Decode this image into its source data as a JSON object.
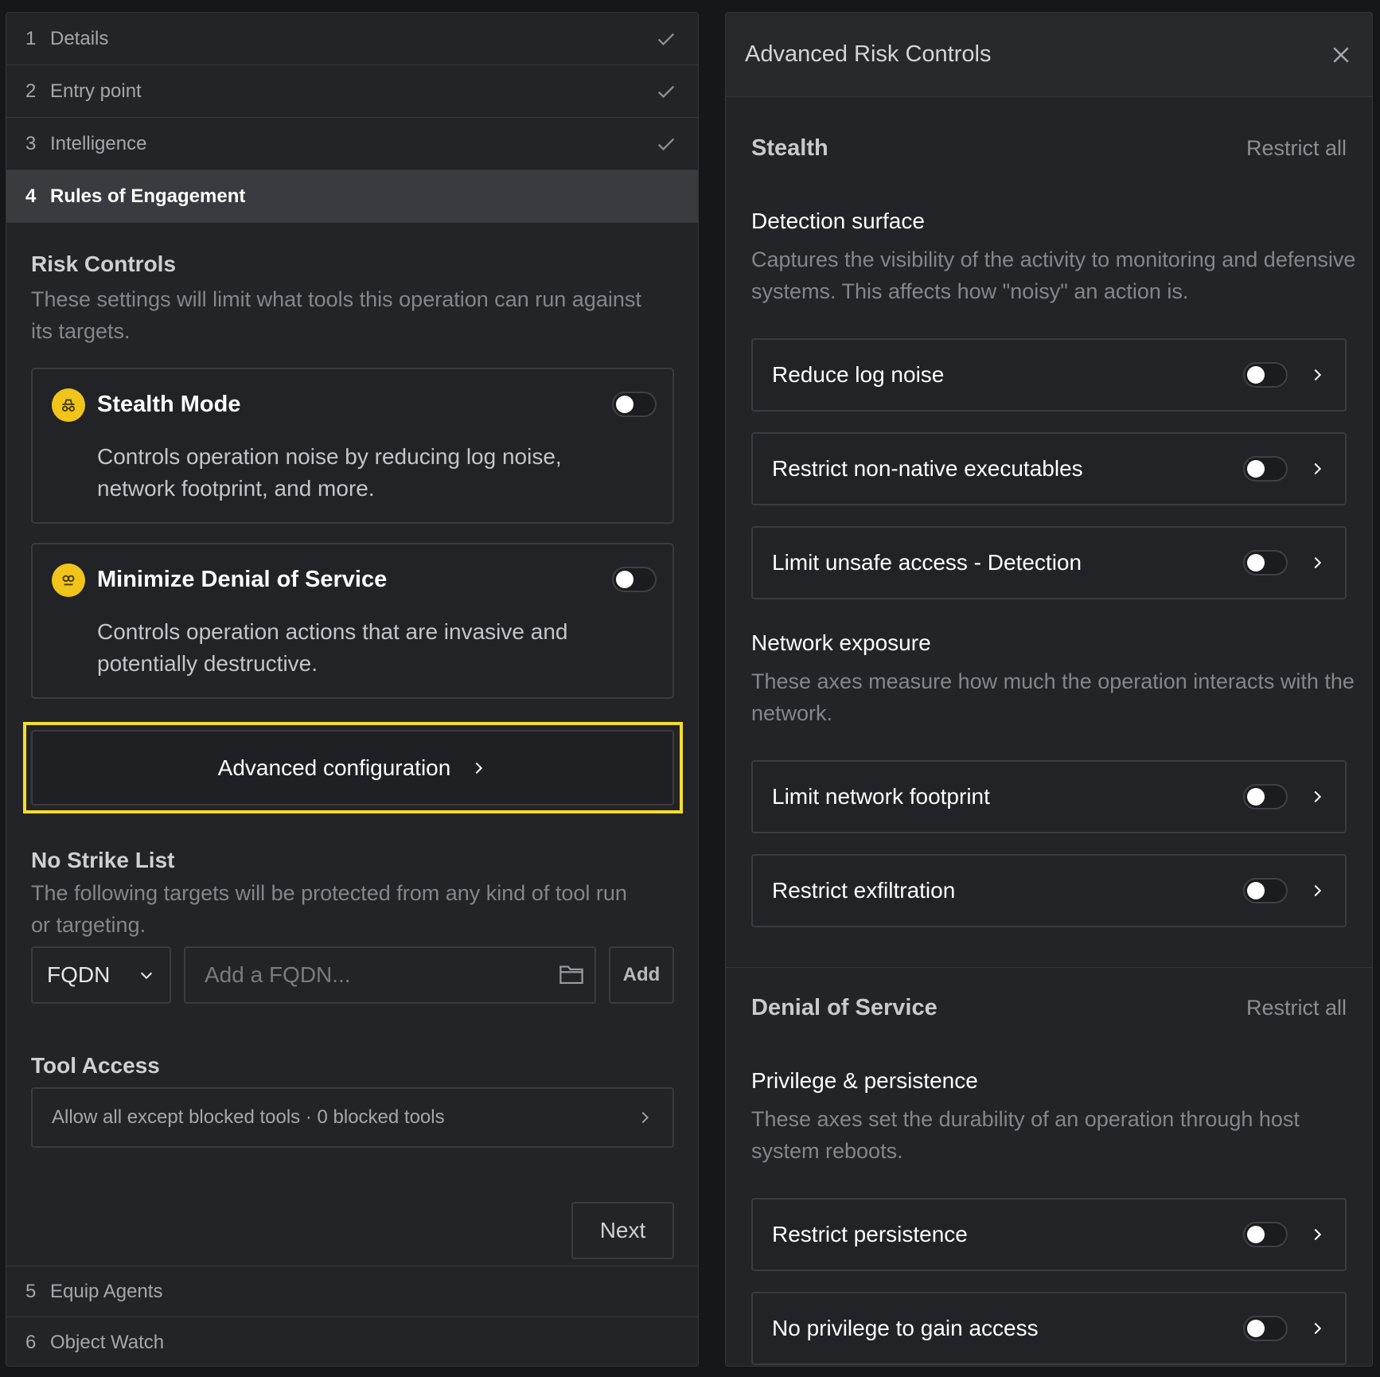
{
  "steps": {
    "s1": {
      "num": "1",
      "label": "Details"
    },
    "s2": {
      "num": "2",
      "label": "Entry point"
    },
    "s3": {
      "num": "3",
      "label": "Intelligence"
    },
    "s4": {
      "num": "4",
      "label": "Rules of Engagement"
    },
    "s5": {
      "num": "5",
      "label": "Equip Agents"
    },
    "s6": {
      "num": "6",
      "label": "Object Watch"
    }
  },
  "risk_controls": {
    "title": "Risk Controls",
    "description": "These settings will limit what tools this operation can run against its targets.",
    "stealth": {
      "title": "Stealth Mode",
      "description": "Controls operation noise by reducing log noise, network footprint, and more.",
      "enabled": false
    },
    "dos": {
      "title": "Minimize Denial of Service",
      "description": "Controls operation actions that are invasive and potentially destructive.",
      "enabled": false
    },
    "advanced_label": "Advanced configuration",
    "accent_color": "#f0c419",
    "highlight_color": "#f5dc2e"
  },
  "no_strike": {
    "title": "No Strike List",
    "description": "The following targets will be protected from any kind of tool run or targeting.",
    "select_value": "FQDN",
    "input_placeholder": "Add a FQDN...",
    "add_label": "Add"
  },
  "tool_access": {
    "title": "Tool Access",
    "summary": "Allow all except blocked tools · 0 blocked tools"
  },
  "next_label": "Next",
  "drawer": {
    "title": "Advanced Risk Controls",
    "stealth": {
      "title": "Stealth",
      "restrict_all": "Restrict all",
      "detection": {
        "title": "Detection surface",
        "description": "Captures the visibility of the activity to monitoring and defensive systems. This affects how \"noisy\" an action is.",
        "items": [
          "Reduce log noise",
          "Restrict non-native executables",
          "Limit unsafe access - Detection"
        ]
      },
      "network": {
        "title": "Network exposure",
        "description": "These axes measure how much the operation interacts with the network.",
        "items": [
          "Limit network footprint",
          "Restrict exfiltration"
        ]
      }
    },
    "dos": {
      "title": "Denial of Service",
      "restrict_all": "Restrict all",
      "privilege": {
        "title": "Privilege & persistence",
        "description": "These axes set the durability of an operation through host system reboots.",
        "items": [
          "Restrict persistence",
          "No privilege to gain access"
        ]
      }
    }
  }
}
